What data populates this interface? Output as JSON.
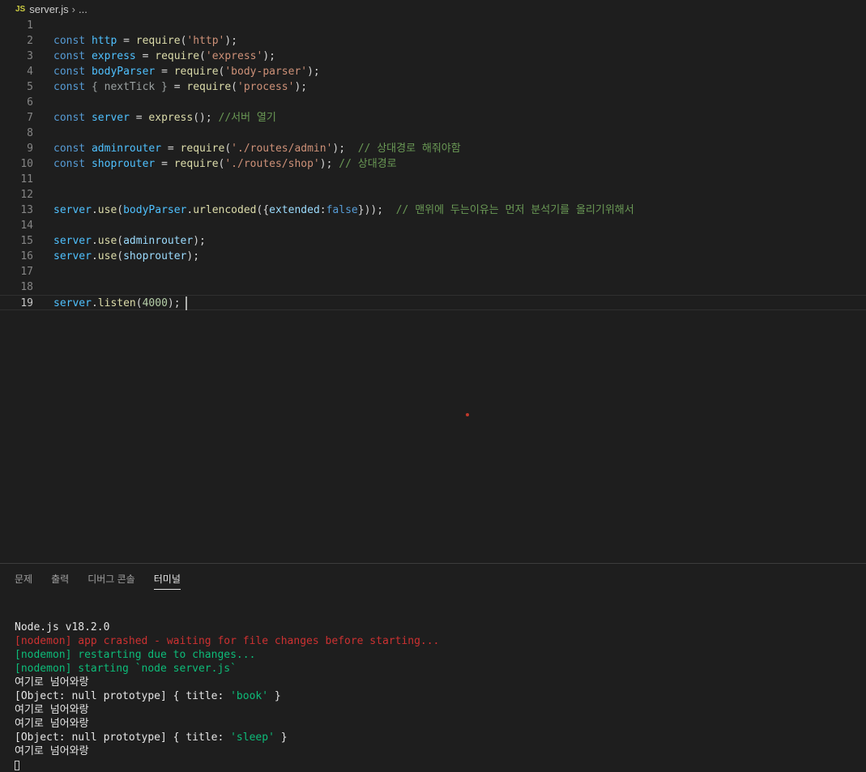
{
  "breadcrumb": {
    "icon": "JS",
    "file": "server.js",
    "more": "..."
  },
  "editor": {
    "lines": [
      {
        "n": "1",
        "tokens": []
      },
      {
        "n": "2",
        "tokens": [
          [
            "kw",
            "const"
          ],
          [
            "pun",
            " "
          ],
          [
            "var",
            "http"
          ],
          [
            "pun",
            " = "
          ],
          [
            "fn",
            "require"
          ],
          [
            "pun",
            "("
          ],
          [
            "str",
            "'http'"
          ],
          [
            "pun",
            ");"
          ]
        ]
      },
      {
        "n": "3",
        "tokens": [
          [
            "kw",
            "const"
          ],
          [
            "pun",
            " "
          ],
          [
            "var",
            "express"
          ],
          [
            "pun",
            " = "
          ],
          [
            "fn",
            "require"
          ],
          [
            "pun",
            "("
          ],
          [
            "str",
            "'express'"
          ],
          [
            "pun",
            ");"
          ]
        ]
      },
      {
        "n": "4",
        "tokens": [
          [
            "kw",
            "const"
          ],
          [
            "pun",
            " "
          ],
          [
            "var",
            "bodyParser"
          ],
          [
            "pun",
            " = "
          ],
          [
            "fn",
            "require"
          ],
          [
            "pun",
            "("
          ],
          [
            "str",
            "'body-parser'"
          ],
          [
            "pun",
            ");"
          ]
        ]
      },
      {
        "n": "5",
        "tokens": [
          [
            "kw",
            "const"
          ],
          [
            "dim",
            " { nextTick } "
          ],
          [
            "pun",
            "= "
          ],
          [
            "fn",
            "require"
          ],
          [
            "pun",
            "("
          ],
          [
            "str",
            "'process'"
          ],
          [
            "pun",
            ");"
          ]
        ]
      },
      {
        "n": "6",
        "tokens": []
      },
      {
        "n": "7",
        "tokens": [
          [
            "kw",
            "const"
          ],
          [
            "pun",
            " "
          ],
          [
            "var",
            "server"
          ],
          [
            "pun",
            " = "
          ],
          [
            "fn",
            "express"
          ],
          [
            "pun",
            "(); "
          ],
          [
            "cmt",
            "//서버 열기"
          ]
        ]
      },
      {
        "n": "8",
        "tokens": []
      },
      {
        "n": "9",
        "tokens": [
          [
            "kw",
            "const"
          ],
          [
            "pun",
            " "
          ],
          [
            "var",
            "adminrouter"
          ],
          [
            "pun",
            " = "
          ],
          [
            "fn",
            "require"
          ],
          [
            "pun",
            "("
          ],
          [
            "str",
            "'./routes/admin'"
          ],
          [
            "pun",
            ");  "
          ],
          [
            "cmt",
            "// 상대경로 해줘야함"
          ]
        ]
      },
      {
        "n": "10",
        "tokens": [
          [
            "kw",
            "const"
          ],
          [
            "pun",
            " "
          ],
          [
            "var",
            "shoprouter"
          ],
          [
            "pun",
            " = "
          ],
          [
            "fn",
            "require"
          ],
          [
            "pun",
            "("
          ],
          [
            "str",
            "'./routes/shop'"
          ],
          [
            "pun",
            "); "
          ],
          [
            "cmt",
            "// 상대경로"
          ]
        ]
      },
      {
        "n": "11",
        "tokens": []
      },
      {
        "n": "12",
        "tokens": []
      },
      {
        "n": "13",
        "tokens": [
          [
            "var",
            "server"
          ],
          [
            "pun",
            "."
          ],
          [
            "fn",
            "use"
          ],
          [
            "pun",
            "("
          ],
          [
            "var",
            "bodyParser"
          ],
          [
            "pun",
            "."
          ],
          [
            "fn",
            "urlencoded"
          ],
          [
            "pun",
            "({"
          ],
          [
            "prop",
            "extended"
          ],
          [
            "pun",
            ":"
          ],
          [
            "kw",
            "false"
          ],
          [
            "pun",
            "}));  "
          ],
          [
            "cmt",
            "// 맨위에 두는이유는 먼저 분석기를 올리기위해서"
          ]
        ]
      },
      {
        "n": "14",
        "tokens": []
      },
      {
        "n": "15",
        "tokens": [
          [
            "var",
            "server"
          ],
          [
            "pun",
            "."
          ],
          [
            "fn",
            "use"
          ],
          [
            "pun",
            "("
          ],
          [
            "prop",
            "adminrouter"
          ],
          [
            "pun",
            ");"
          ]
        ]
      },
      {
        "n": "16",
        "tokens": [
          [
            "var",
            "server"
          ],
          [
            "pun",
            "."
          ],
          [
            "fn",
            "use"
          ],
          [
            "pun",
            "("
          ],
          [
            "prop",
            "shoprouter"
          ],
          [
            "pun",
            ");"
          ]
        ]
      },
      {
        "n": "17",
        "tokens": []
      },
      {
        "n": "18",
        "tokens": []
      },
      {
        "n": "19",
        "tokens": [
          [
            "var",
            "server"
          ],
          [
            "pun",
            "."
          ],
          [
            "fn",
            "listen"
          ],
          [
            "pun",
            "("
          ],
          [
            "num",
            "4000"
          ],
          [
            "pun",
            ");"
          ]
        ],
        "current": true
      }
    ]
  },
  "panel": {
    "tabs": [
      {
        "label": "문제",
        "active": false
      },
      {
        "label": "출력",
        "active": false
      },
      {
        "label": "디버그 콘솔",
        "active": false
      },
      {
        "label": "터미널",
        "active": true
      }
    ],
    "terminal": [
      [
        [
          "t-white",
          "Node.js v18.2.0"
        ]
      ],
      [
        [
          "t-red",
          "[nodemon] app crashed - waiting for file changes before starting..."
        ]
      ],
      [
        [
          "t-green",
          "[nodemon] restarting due to changes..."
        ]
      ],
      [
        [
          "t-green",
          "[nodemon] starting `node server.js`"
        ]
      ],
      [
        [
          "t-white",
          "여기로 넘어와랑"
        ]
      ],
      [
        [
          "t-white",
          "[Object: null prototype] { title: "
        ],
        [
          "t-green",
          "'book'"
        ],
        [
          "t-white",
          " }"
        ]
      ],
      [
        [
          "t-white",
          "여기로 넘어와랑"
        ]
      ],
      [
        [
          "t-white",
          "여기로 넘어와랑"
        ]
      ],
      [
        [
          "t-white",
          "[Object: null prototype] { title: "
        ],
        [
          "t-green",
          "'sleep'"
        ],
        [
          "t-white",
          " }"
        ]
      ],
      [
        [
          "t-white",
          "여기로 넘어와랑"
        ]
      ]
    ]
  }
}
